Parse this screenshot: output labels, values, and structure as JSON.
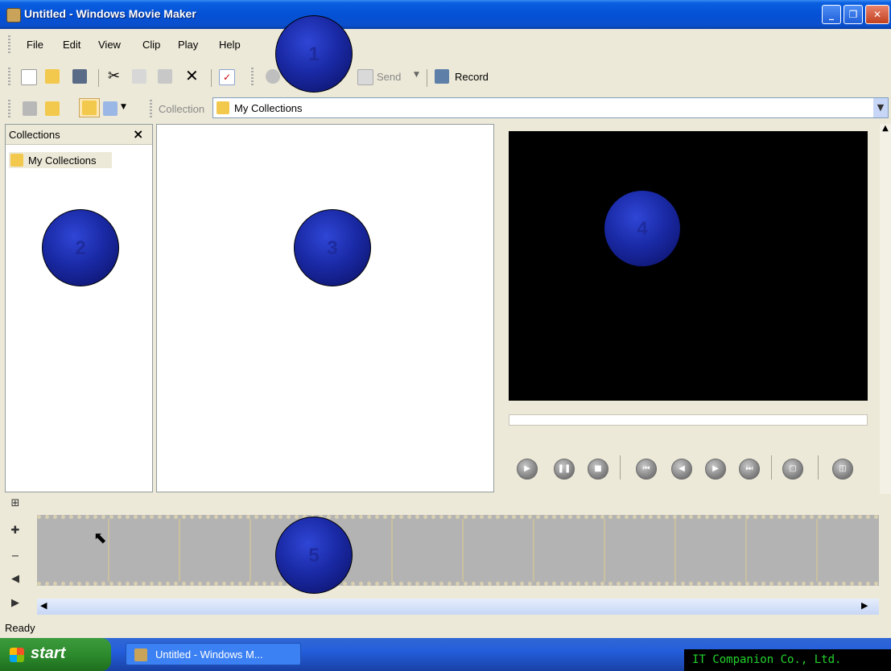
{
  "window": {
    "title": "Untitled - Windows Movie Maker"
  },
  "menu": [
    "File",
    "Edit",
    "View",
    "Clip",
    "Play",
    "Help"
  ],
  "toolbar": {
    "send_label": "Send",
    "record_label": "Record"
  },
  "collection_bar": {
    "label": "Collection",
    "value": "My Collections"
  },
  "collections_pane": {
    "header": "Collections",
    "close": "×",
    "items": [
      "My Collections"
    ]
  },
  "status": {
    "text": "Ready"
  },
  "taskbar": {
    "start_label": "start",
    "task_label": "Untitled - Windows M...",
    "tray_text": "IT Companion Co., Ltd."
  },
  "callouts": [
    "1",
    "2",
    "3",
    "4",
    "5"
  ],
  "colors": {
    "titlebar": "#0451d6",
    "callout": "#1a2aa6",
    "taskbar": "#245edb",
    "tray_text": "#22d22d"
  }
}
